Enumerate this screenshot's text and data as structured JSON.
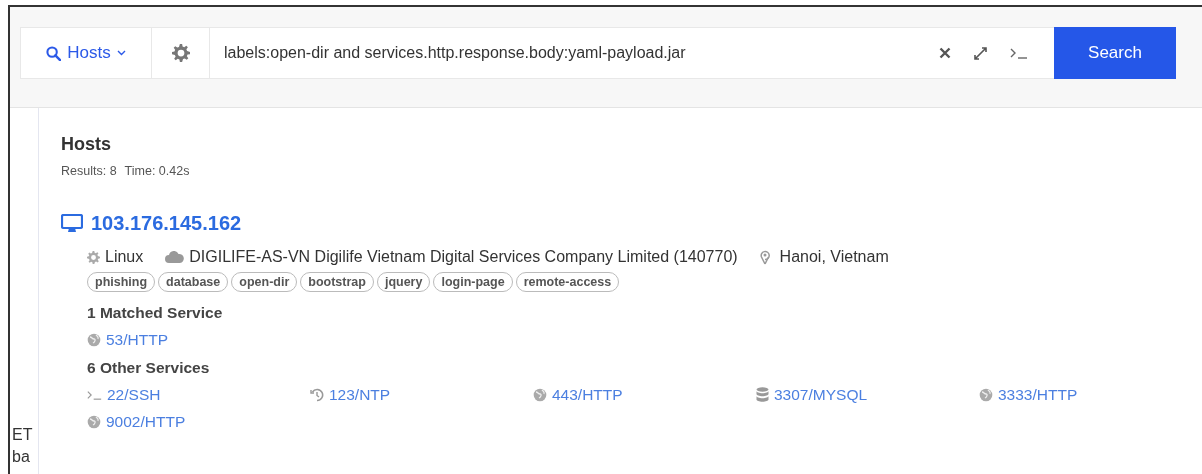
{
  "search": {
    "scope": "Hosts",
    "query": "labels:open-dir and services.http.response.body:yaml-payload.jar",
    "button": "Search"
  },
  "sidebar": {
    "items": [
      "ET",
      "ba"
    ]
  },
  "results": {
    "title": "Hosts",
    "count": "Results: 8",
    "time": "Time: 0.42s"
  },
  "host": {
    "ip": "103.176.145.162",
    "os": "Linux",
    "asn": "DIGILIFE-AS-VN Digilife Vietnam Digital Services Company Limited (140770)",
    "location": "Hanoi, Vietnam",
    "labels": [
      "phishing",
      "database",
      "open-dir",
      "bootstrap",
      "jquery",
      "login-page",
      "remote-access"
    ],
    "matched_title": "1 Matched Service",
    "matched": [
      {
        "kind": "web",
        "label": "53/HTTP"
      }
    ],
    "other_title": "6 Other Services",
    "other": [
      {
        "kind": "terminal",
        "label": "22/SSH"
      },
      {
        "kind": "clock",
        "label": "123/NTP"
      },
      {
        "kind": "web",
        "label": "443/HTTP"
      },
      {
        "kind": "database",
        "label": "3307/MYSQL"
      },
      {
        "kind": "web",
        "label": "3333/HTTP"
      },
      {
        "kind": "web",
        "label": "9002/HTTP"
      }
    ]
  }
}
